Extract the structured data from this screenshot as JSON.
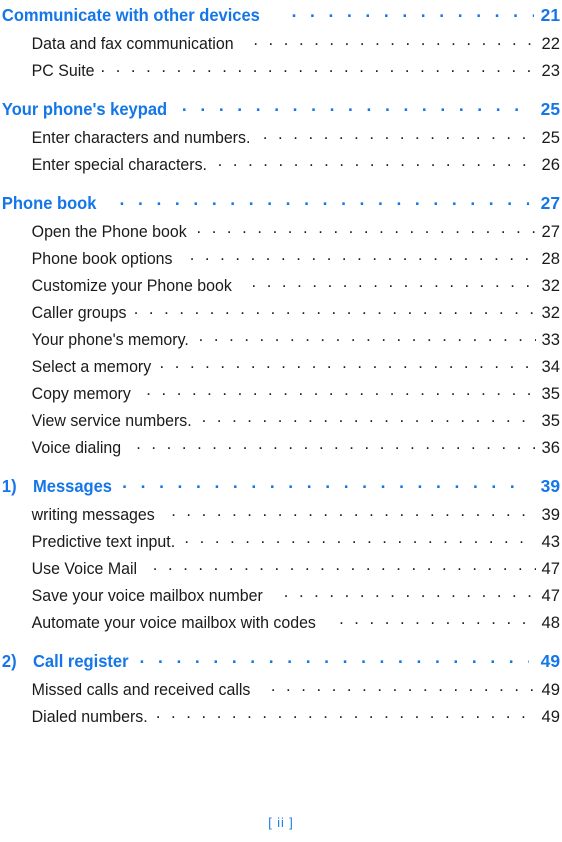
{
  "colors": {
    "heading_blue": "#1476E8",
    "body_black": "#1a1a1a",
    "page_background": "#ffffff"
  },
  "document": {
    "type": "table-of-contents",
    "footer_page_label": "[ ii ]"
  },
  "leader_dots": {
    "section": ". . . . . . . . . . . . . . . . . . . . . . . . . . . . . . . . . . . . . . . . . . . . . . . . . . . . . . . .",
    "sub": ". . . . . . . . . . . . . . . . . . . . . . . . . . . . . . . . . . . . . . . . . . . . . . . . . . . . . . . . . . . . . ."
  },
  "sections": [
    {
      "marker": "",
      "title": "Communicate with other devices",
      "page": "21",
      "gap": true,
      "tight": true,
      "items": [
        {
          "title": "Data and fax communication",
          "page": "22",
          "wgap": true
        },
        {
          "title": "PC Suite",
          "page": "23",
          "wgap": false
        }
      ]
    },
    {
      "marker": "",
      "title": "Your phone's keypad",
      "page": "25",
      "gap": false,
      "tight": false,
      "items": [
        {
          "title": "Enter characters and numbers.",
          "page": "25",
          "wgap": false
        },
        {
          "title": "Enter special characters.",
          "page": "26",
          "wgap": false
        }
      ]
    },
    {
      "marker": "",
      "title": "Phone book",
      "page": "27",
      "gap": true,
      "tight": false,
      "items": [
        {
          "title": "Open the Phone book",
          "page": "27",
          "wgap": false
        },
        {
          "title": "Phone book options",
          "page": "28",
          "wgap": true
        },
        {
          "title": "Customize your Phone book",
          "page": "32",
          "wgap": true
        },
        {
          "title": "Caller groups",
          "page": "32",
          "wgap": false
        },
        {
          "title": "Your phone's memory.",
          "page": "33",
          "wgap": false
        },
        {
          "title": "Select a memory",
          "page": "34",
          "wgap": false
        },
        {
          "title": "Copy memory",
          "page": "35",
          "wgap": true
        },
        {
          "title": "View service numbers.",
          "page": "35",
          "wgap": false
        },
        {
          "title": "Voice dialing",
          "page": "36",
          "wgap": true
        }
      ]
    },
    {
      "marker": "1)",
      "title": "Messages",
      "page": "39",
      "gap": false,
      "tight": false,
      "items": [
        {
          "title": "writing messages",
          "page": "39",
          "wgap": true
        },
        {
          "title": "Predictive text input.",
          "page": "43",
          "wgap": false
        },
        {
          "title": "Use Voice Mail",
          "page": "47",
          "wgap": true
        },
        {
          "title": "Save your voice mailbox number",
          "page": "47",
          "wgap": true
        },
        {
          "title": "Automate your voice mailbox with codes",
          "page": "48",
          "wgap": true
        }
      ]
    },
    {
      "marker": "2)",
      "title": "Call register",
      "page": "49",
      "gap": false,
      "tight": false,
      "items": [
        {
          "title": "Missed calls and received calls",
          "page": "49",
          "wgap": true
        },
        {
          "title": "Dialed numbers.",
          "page": "49",
          "wgap": false
        }
      ]
    }
  ]
}
